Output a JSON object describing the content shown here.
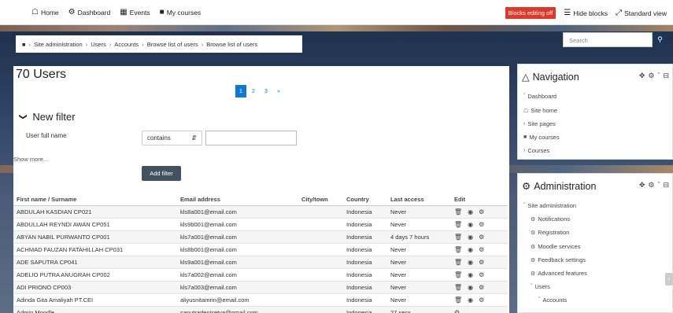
{
  "navbar": {
    "home": "Home",
    "dashboard": "Dashboard",
    "events": "Events",
    "my_courses": "My courses",
    "blocks_editing": "Blocks editing off",
    "hide_blocks": "Hide blocks",
    "standard_view": "Standard view"
  },
  "breadcrumb": {
    "items": [
      "Site administration",
      "Users",
      "Accounts",
      "Browse list of users",
      "Browse list of users"
    ]
  },
  "page": {
    "title": "70 Users",
    "pagination": [
      "1",
      "2",
      "3",
      "»"
    ],
    "active_page": "1"
  },
  "filter": {
    "heading": "New filter",
    "field_label": "User full name",
    "operator_value": "contains",
    "text_value": "",
    "show_more": "Show more...",
    "add_button": "Add filter"
  },
  "table": {
    "headers": [
      "First name / Surname",
      "Email address",
      "City/town",
      "Country",
      "Last access",
      "Edit"
    ],
    "rows": [
      {
        "name": "ABDULAH KASDIAN CP021",
        "email": "kls8a001@email.com",
        "city": "",
        "country": "Indonesia",
        "last": "Never"
      },
      {
        "name": "ABDULLAH REYNDI AWAN CP051",
        "email": "kls9b001@email.com",
        "city": "",
        "country": "Indonesia",
        "last": "Never"
      },
      {
        "name": "ABYAN NABIL PURWANTO CP001",
        "email": "kls7a001@email.com",
        "city": "",
        "country": "Indonesia",
        "last": "4 days 7 hours"
      },
      {
        "name": "ACHMAD FAUZAN FATAHILLAH CP031",
        "email": "kls8b001@email.com",
        "city": "",
        "country": "Indonesia",
        "last": "Never"
      },
      {
        "name": "ADE SAPUTRA CP041",
        "email": "kls9a001@email.com",
        "city": "",
        "country": "Indonesia",
        "last": "Never"
      },
      {
        "name": "ADELIO PUTRA ANUGRAH CP002",
        "email": "kls7a002@email.com",
        "city": "",
        "country": "Indonesia",
        "last": "Never"
      },
      {
        "name": "ADI PRIONO CP003",
        "email": "kls7a003@email.com",
        "city": "",
        "country": "Indonesia",
        "last": "Never"
      },
      {
        "name": "Adinda Gita Amaliyah PT.CEI",
        "email": "aliyusnitamrin@email.com",
        "city": "",
        "country": "Indonesia",
        "last": "Never"
      },
      {
        "name": "Admin Moodle",
        "email": "saputradenisetya@gmail.com",
        "city": "",
        "country": "Indonesia",
        "last": "27 secs"
      }
    ]
  },
  "sidebar": {
    "search_placeholder": "Search",
    "navigation": {
      "title": "Navigation",
      "items": [
        "Dashboard",
        "Site home",
        "Site pages",
        "My courses",
        "Courses"
      ]
    },
    "administration": {
      "title": "Administration",
      "items": [
        "Site administration",
        "Notifications",
        "Registration",
        "Moodle services",
        "Feedback settings",
        "Advanced features",
        "Users",
        "Accounts"
      ]
    }
  },
  "colors": {
    "accent_blue": "#1177d1",
    "blocks_red": "#e0392b",
    "button_dark": "#44525f",
    "search_button": "#1d3556"
  }
}
